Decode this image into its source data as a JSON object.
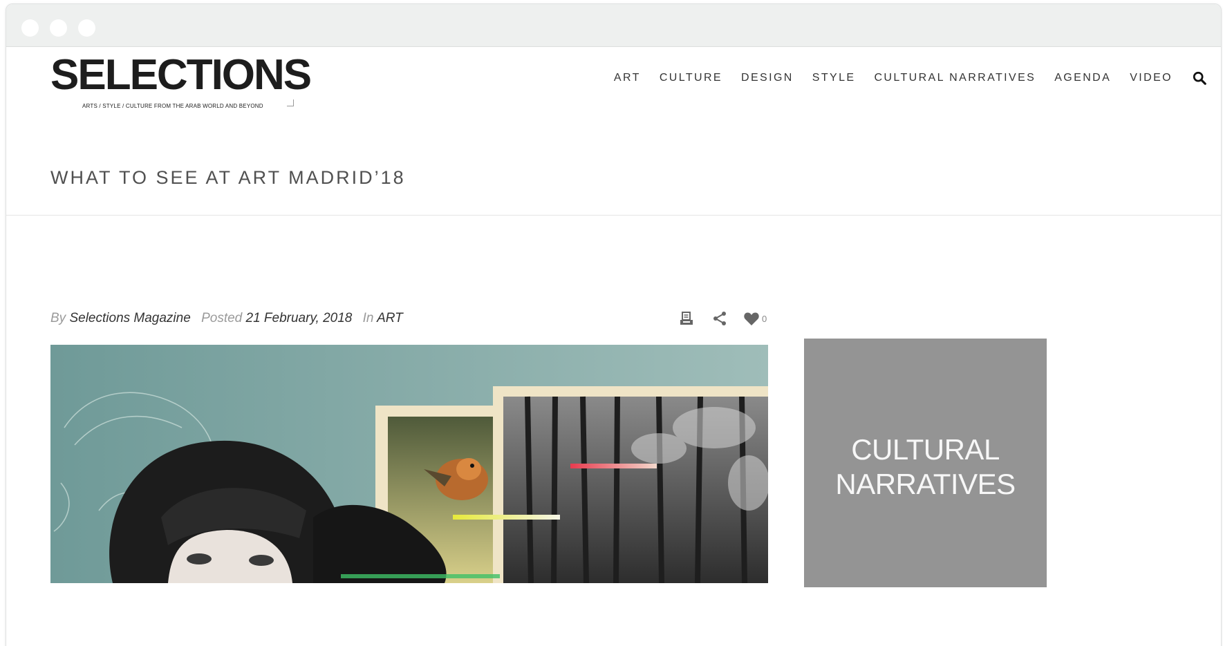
{
  "site": {
    "logo": "SELECTIONS",
    "tagline": "ARTS / STYLE / CULTURE FROM THE ARAB WORLD AND BEYOND"
  },
  "nav": {
    "items": [
      "ART",
      "CULTURE",
      "DESIGN",
      "STYLE",
      "CULTURAL NARRATIVES",
      "AGENDA",
      "VIDEO"
    ]
  },
  "article": {
    "title": "WHAT TO SEE AT ART MADRID’18",
    "by_label": "By",
    "author": "Selections Magazine",
    "posted_label": "Posted",
    "date": "21 February, 2018",
    "in_label": "In",
    "category": "ART",
    "like_count": "0"
  },
  "sidebar": {
    "banner_line1": "CULTURAL",
    "banner_line2": "NARRATIVES"
  },
  "icons": {
    "print": "print-icon",
    "share": "share-icon",
    "like": "heart-icon",
    "search": "search-icon"
  },
  "colors": {
    "banner_bg": "#949494",
    "text_dark": "#1d1d1d",
    "meta_muted": "#9a9a9a"
  }
}
